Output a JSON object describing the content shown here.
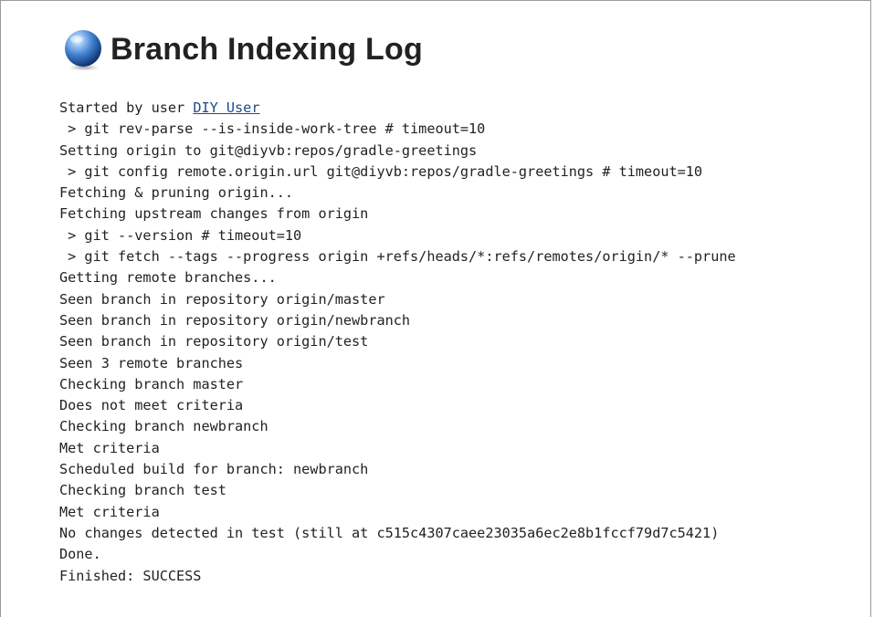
{
  "page": {
    "title": "Branch Indexing Log",
    "status_icon": "blue-ball-icon"
  },
  "log": {
    "started_prefix": "Started by user ",
    "started_user": "DIY User",
    "lines": [
      " > git rev-parse --is-inside-work-tree # timeout=10",
      "Setting origin to git@diyvb:repos/gradle-greetings",
      " > git config remote.origin.url git@diyvb:repos/gradle-greetings # timeout=10",
      "Fetching & pruning origin...",
      "Fetching upstream changes from origin",
      " > git --version # timeout=10",
      " > git fetch --tags --progress origin +refs/heads/*:refs/remotes/origin/* --prune",
      "Getting remote branches...",
      "Seen branch in repository origin/master",
      "Seen branch in repository origin/newbranch",
      "Seen branch in repository origin/test",
      "Seen 3 remote branches",
      "Checking branch master",
      "Does not meet criteria",
      "Checking branch newbranch",
      "Met criteria",
      "Scheduled build for branch: newbranch",
      "Checking branch test",
      "Met criteria",
      "No changes detected in test (still at c515c4307caee23035a6ec2e8b1fccf79d7c5421)",
      "Done.",
      "Finished: SUCCESS"
    ]
  },
  "colors": {
    "link": "#204a87",
    "text": "#222222",
    "ball_light": "#cfe3ff",
    "ball_mid": "#3f7fd0",
    "ball_dark": "#0d2f6b"
  }
}
